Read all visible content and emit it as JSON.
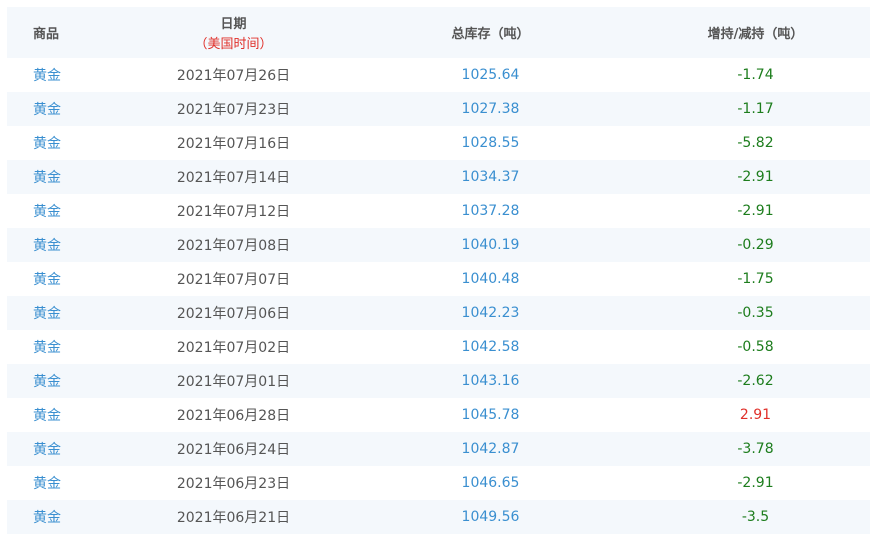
{
  "headers": {
    "commodity": "商品",
    "date": "日期",
    "date_note": "（美国时间）",
    "total_stock": "总库存（吨）",
    "change": "增持/减持（吨）"
  },
  "colors": {
    "link_blue": "#3a8fd0",
    "negative_green": "#1d7d1d",
    "positive_red": "#e0302a",
    "row_stripe": "#f4f8fc"
  },
  "rows": [
    {
      "commodity": "黄金",
      "date": "2021年07月26日",
      "stock": "1025.64",
      "change": "-1.74"
    },
    {
      "commodity": "黄金",
      "date": "2021年07月23日",
      "stock": "1027.38",
      "change": "-1.17"
    },
    {
      "commodity": "黄金",
      "date": "2021年07月16日",
      "stock": "1028.55",
      "change": "-5.82"
    },
    {
      "commodity": "黄金",
      "date": "2021年07月14日",
      "stock": "1034.37",
      "change": "-2.91"
    },
    {
      "commodity": "黄金",
      "date": "2021年07月12日",
      "stock": "1037.28",
      "change": "-2.91"
    },
    {
      "commodity": "黄金",
      "date": "2021年07月08日",
      "stock": "1040.19",
      "change": "-0.29"
    },
    {
      "commodity": "黄金",
      "date": "2021年07月07日",
      "stock": "1040.48",
      "change": "-1.75"
    },
    {
      "commodity": "黄金",
      "date": "2021年07月06日",
      "stock": "1042.23",
      "change": "-0.35"
    },
    {
      "commodity": "黄金",
      "date": "2021年07月02日",
      "stock": "1042.58",
      "change": "-0.58"
    },
    {
      "commodity": "黄金",
      "date": "2021年07月01日",
      "stock": "1043.16",
      "change": "-2.62"
    },
    {
      "commodity": "黄金",
      "date": "2021年06月28日",
      "stock": "1045.78",
      "change": "2.91"
    },
    {
      "commodity": "黄金",
      "date": "2021年06月24日",
      "stock": "1042.87",
      "change": "-3.78"
    },
    {
      "commodity": "黄金",
      "date": "2021年06月23日",
      "stock": "1046.65",
      "change": "-2.91"
    },
    {
      "commodity": "黄金",
      "date": "2021年06月21日",
      "stock": "1049.56",
      "change": "-3.5"
    }
  ]
}
